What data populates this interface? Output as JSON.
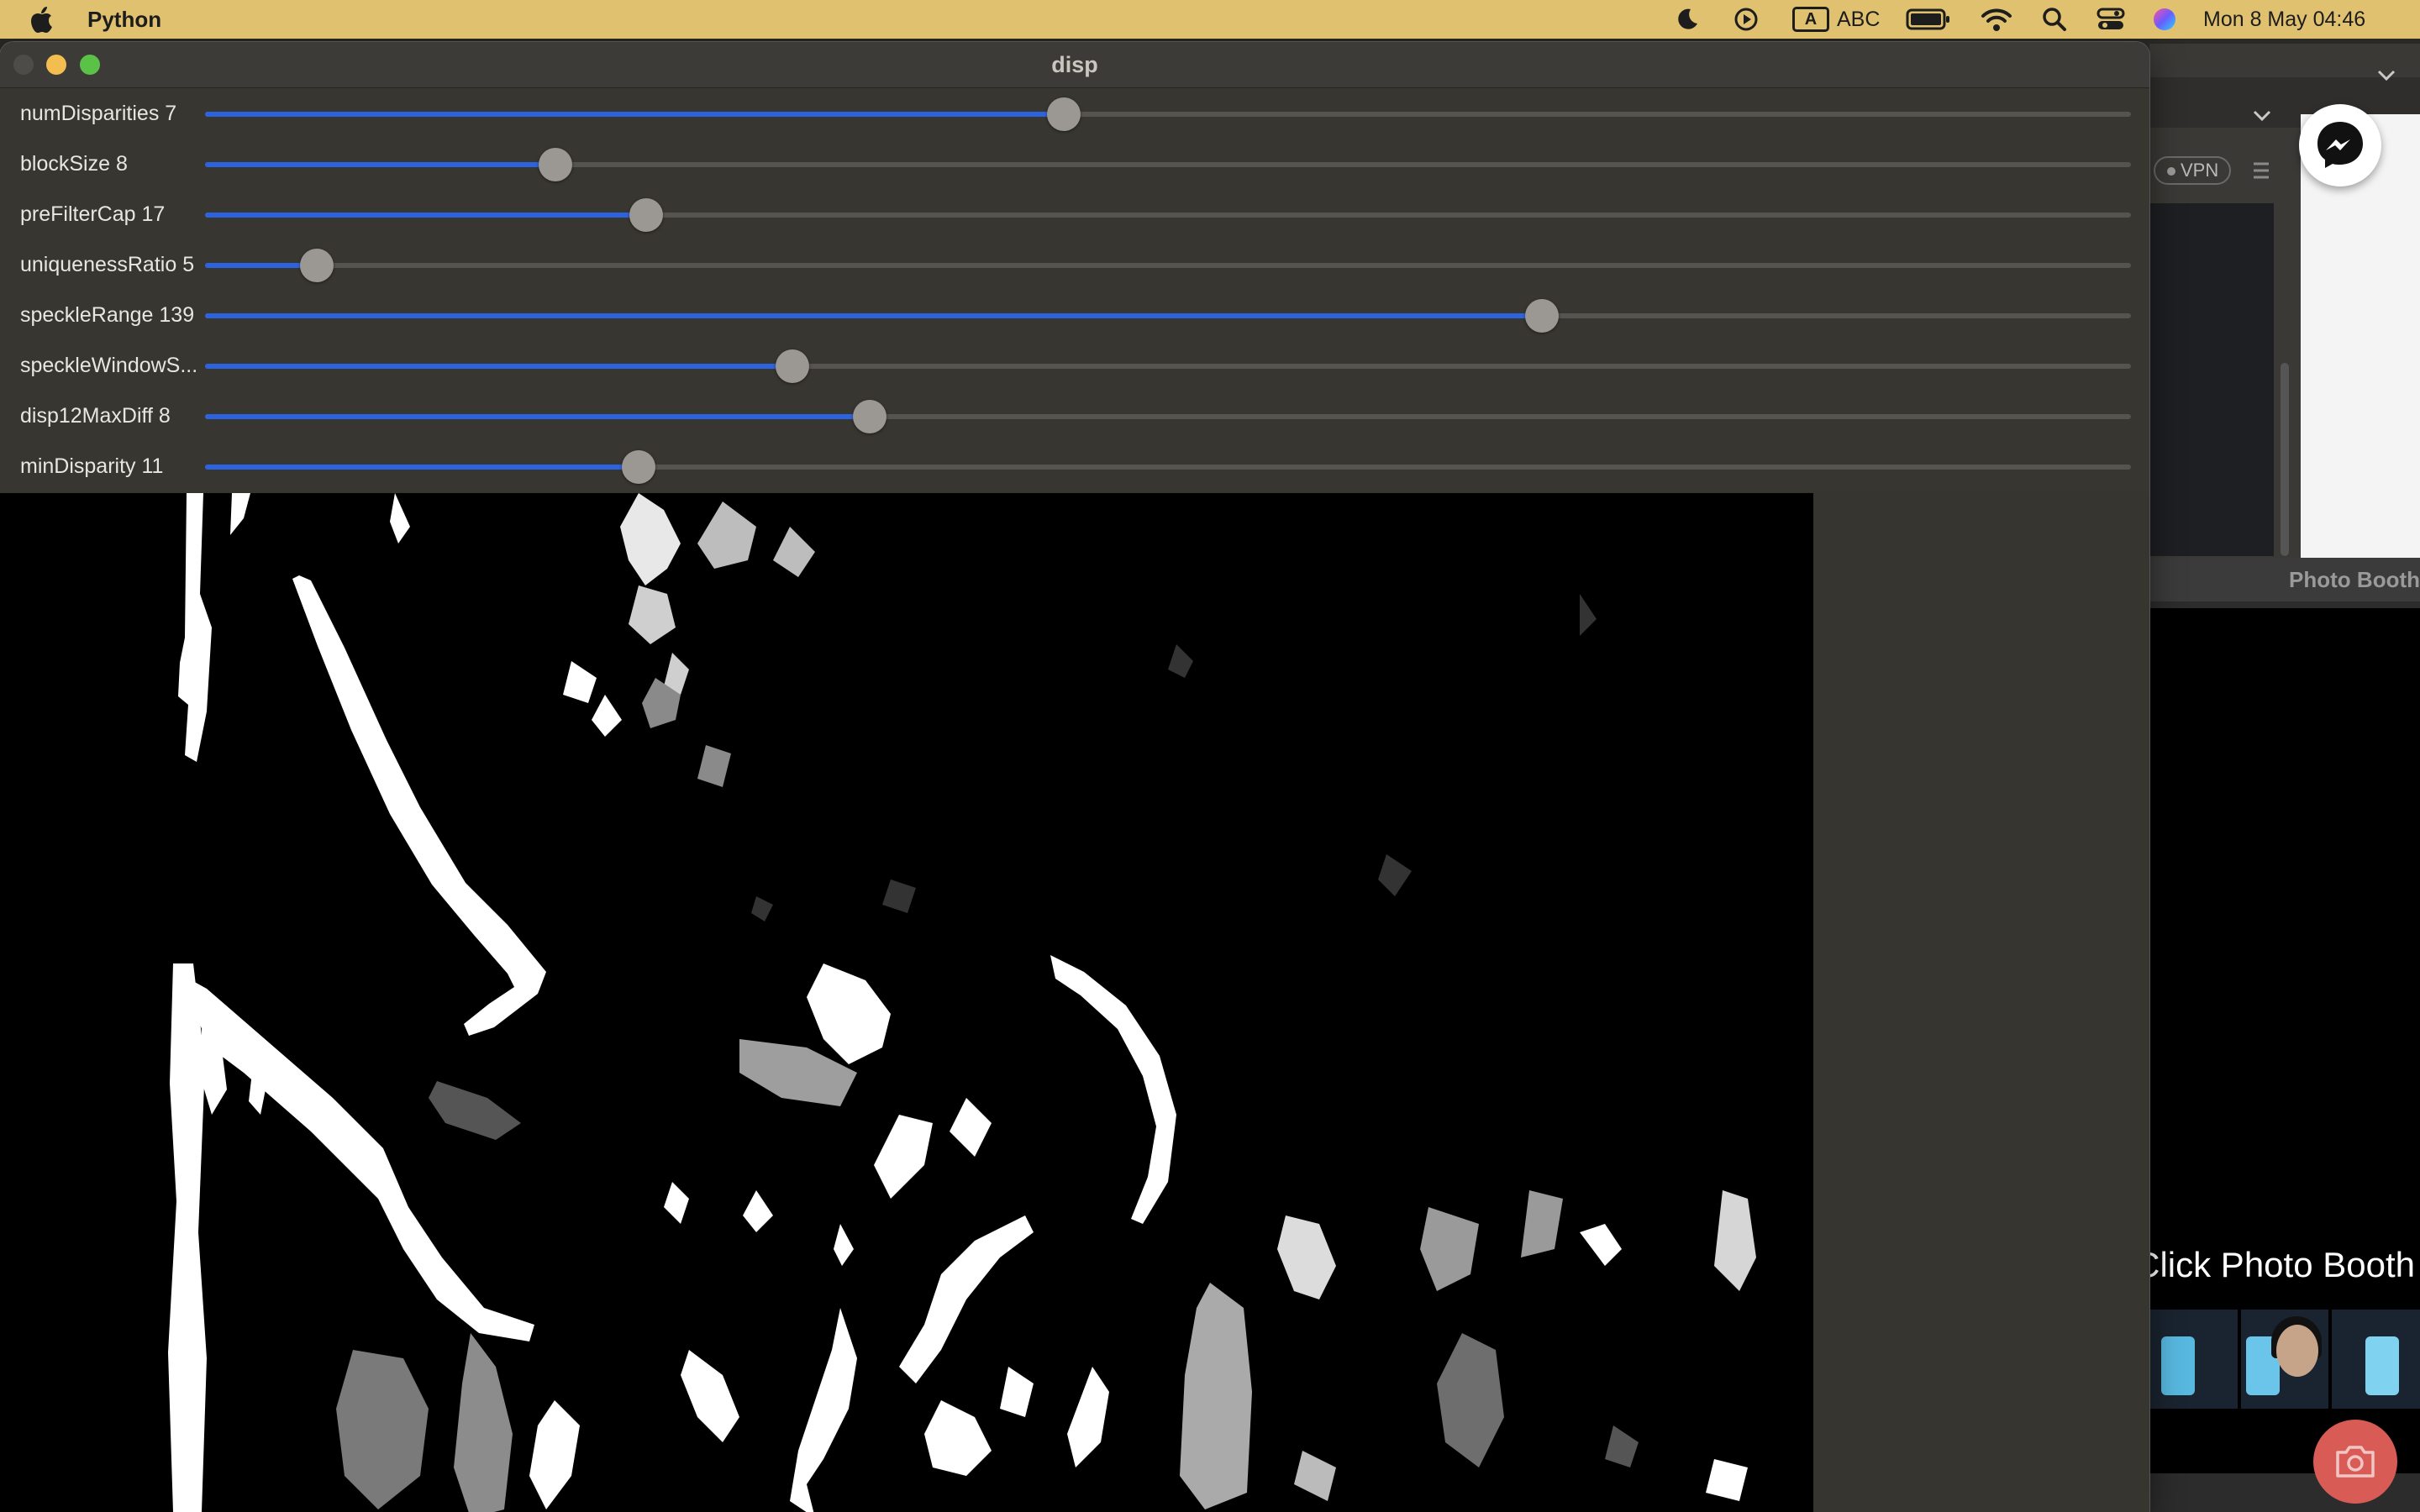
{
  "menubar": {
    "app_name": "Python",
    "input_source": "ABC",
    "input_badge": "A",
    "datetime": "Mon 8 May  04:46",
    "icons": [
      "apple-icon",
      "moon-icon",
      "play-icon",
      "keyboard-input-icon",
      "battery-icon",
      "wifi-icon",
      "search-icon",
      "control-center-icon",
      "siri-icon"
    ]
  },
  "window": {
    "title": "disp",
    "sliders": [
      {
        "label": "numDisparities 7",
        "value": 0.446
      },
      {
        "label": "blockSize 8",
        "value": 0.182
      },
      {
        "label": "preFilterCap 17",
        "value": 0.229
      },
      {
        "label": "uniquenessRatio 5",
        "value": 0.058
      },
      {
        "label": "speckleRange 139",
        "value": 0.694
      },
      {
        "label": "speckleWindowS...",
        "value": 0.305
      },
      {
        "label": "disp12MaxDiff 8",
        "value": 0.345
      },
      {
        "label": "minDisparity 11",
        "value": 0.225
      }
    ]
  },
  "background": {
    "vpn_label": "VPN",
    "photo_booth_title": "Photo Booth",
    "photo_booth_caption": "Click Photo Booth"
  },
  "colors": {
    "menubar": "#e0c170",
    "slider_fill": "#2e63e0",
    "window_bg": "#373530",
    "camera_button": "#d95b56"
  }
}
